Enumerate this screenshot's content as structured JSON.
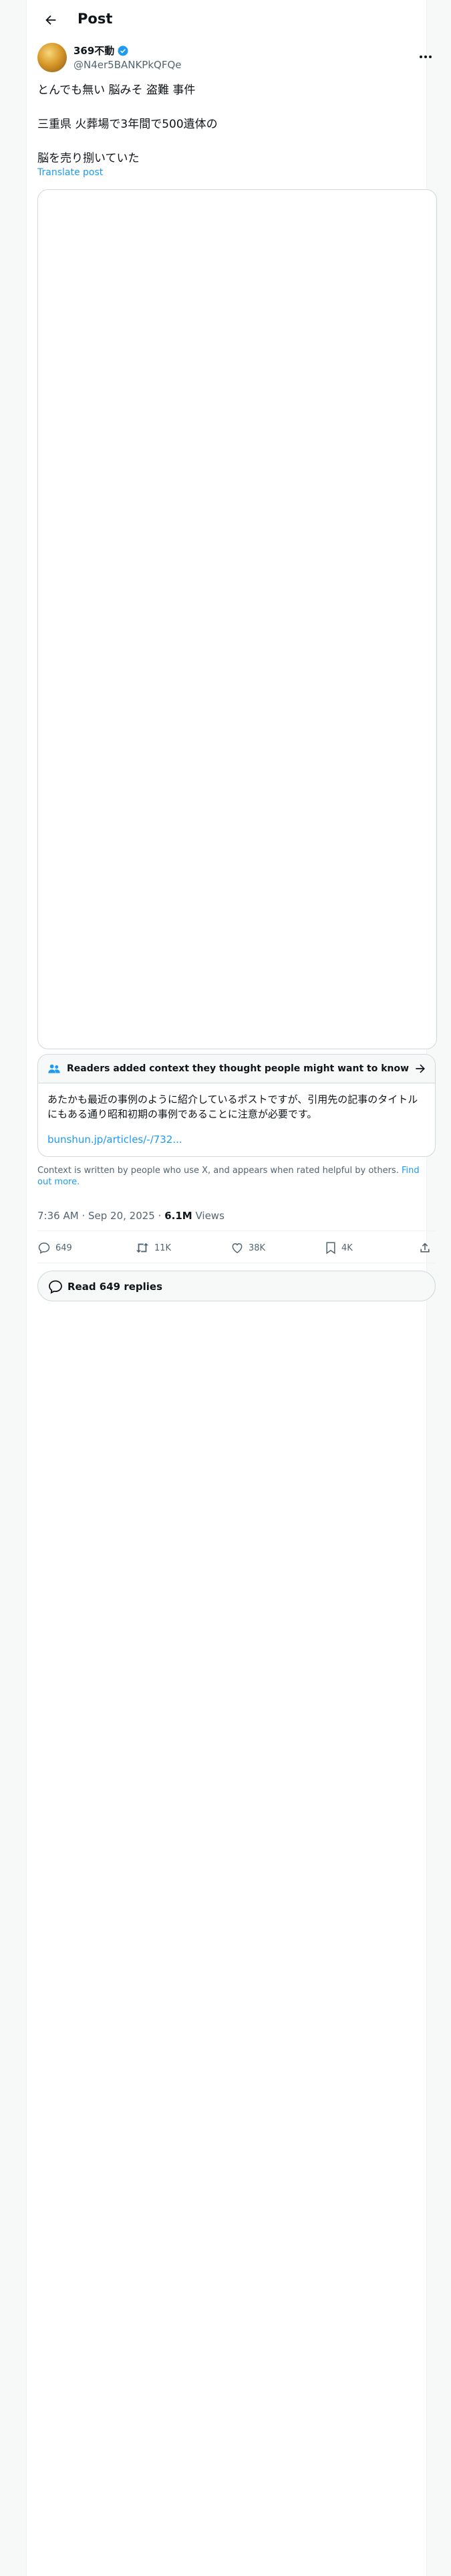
{
  "header": {
    "title": "Post"
  },
  "author": {
    "name": "369不動",
    "handle": "@N4er5BANKPkQFQe"
  },
  "tweet": {
    "lines": [
      "とんでも無い 脳みそ 盗難 事件",
      "三重県 火葬場で3年間で500遺体の",
      "脳を売り捌いていた"
    ],
    "translate_label": "Translate post"
  },
  "community_note": {
    "title": "Readers added context they thought people might want to know",
    "body": "あたかも最近の事例のように紹介しているポストですが、引用先の記事のタイトルにもある通り昭和初期の事例であることに注意が必要です。",
    "link": "bunshun.jp/articles/-/732...",
    "footer_text": "Context is written by people who use X, and appears when rated helpful by others.",
    "footer_link": "Find out more."
  },
  "meta": {
    "time": "7:36 AM",
    "sep": "·",
    "date": "Sep 20, 2025",
    "views_count": "6.1M",
    "views_label": "Views"
  },
  "actions": {
    "replies": "649",
    "reposts": "11K",
    "likes": "38K",
    "bookmarks": "4K"
  },
  "read_replies": {
    "label": "Read 649 replies"
  },
  "colors": {
    "accent": "#1d9bf0",
    "text": "#0f1419",
    "muted": "#536471",
    "border": "#cfd9de"
  }
}
